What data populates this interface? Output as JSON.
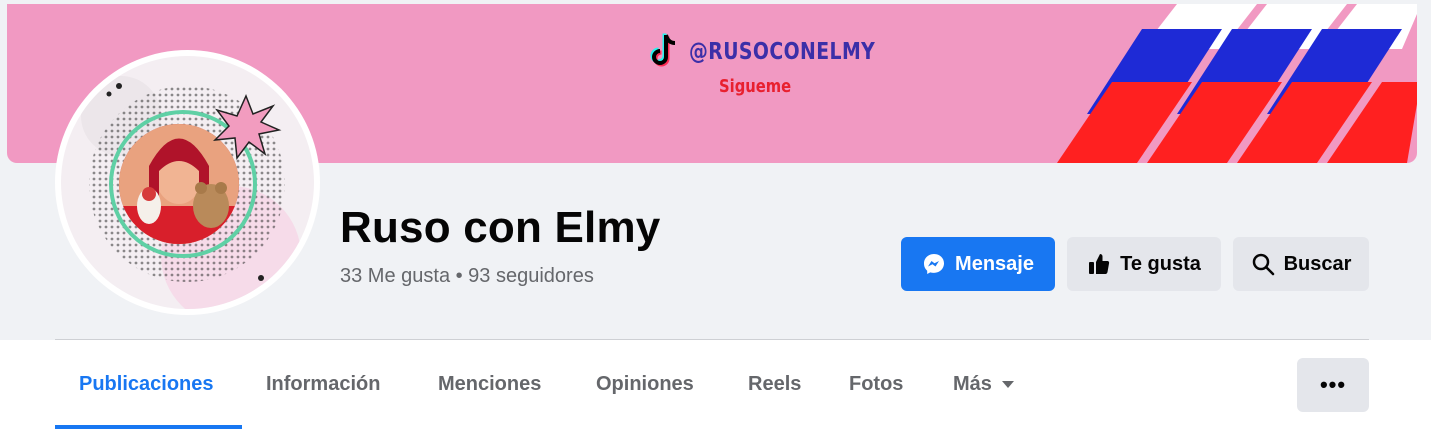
{
  "cover": {
    "tiktok_handle": "@RUSOCONELMY",
    "tiktok_cta": "Sigueme",
    "background_color": "#f199c2"
  },
  "profile": {
    "name": "Ruso con Elmy",
    "stats": "33 Me gusta • 93 seguidores"
  },
  "actions": {
    "message_label": "Mensaje",
    "like_label": "Te gusta",
    "search_label": "Buscar",
    "more_label": "•••"
  },
  "tabs": [
    {
      "label": "Publicaciones",
      "active": true
    },
    {
      "label": "Información"
    },
    {
      "label": "Menciones"
    },
    {
      "label": "Opiniones"
    },
    {
      "label": "Reels"
    },
    {
      "label": "Fotos"
    },
    {
      "label": "Más"
    }
  ],
  "colors": {
    "accent": "#1877f2",
    "page_bg": "#f0f2f5",
    "button_secondary": "#e4e6eb",
    "muted_text": "#65676b"
  },
  "icons": {
    "tiktok": "tiktok-icon",
    "message": "messenger-icon",
    "like": "thumbs-up-icon",
    "search": "search-icon",
    "more": "more-dots-icon",
    "dropdown": "caret-down-icon"
  }
}
